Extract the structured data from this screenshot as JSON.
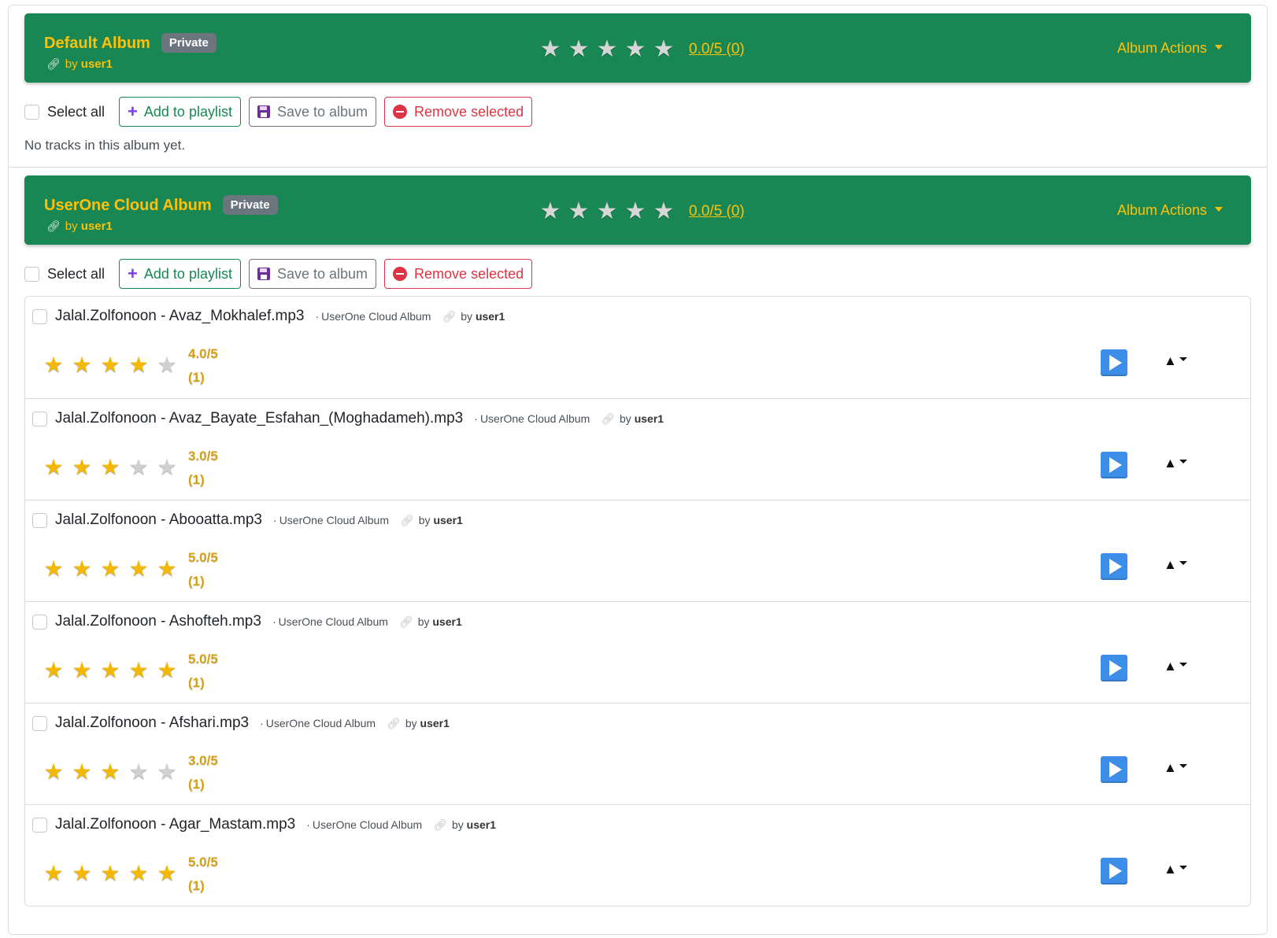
{
  "albums": [
    {
      "title": "Default Album",
      "badge": "Private",
      "owner_prefix": "by",
      "owner": "user1",
      "rating_text": "0.0/5 (0)",
      "actions_label": "Album Actions",
      "select_all": "Select all",
      "add_label": "Add to playlist",
      "save_label": "Save to album",
      "remove_label": "Remove selected",
      "empty_text": "No tracks in this album yet."
    },
    {
      "title": "UserOne Cloud Album",
      "badge": "Private",
      "owner_prefix": "by",
      "owner": "user1",
      "rating_text": "0.0/5 (0)",
      "actions_label": "Album Actions",
      "select_all": "Select all",
      "add_label": "Add to playlist",
      "save_label": "Save to album",
      "remove_label": "Remove selected"
    }
  ],
  "tracks": [
    {
      "title": "Jalal.Zolfonoon - Avaz_Mokhalef.mp3",
      "album": "UserOne Cloud Album",
      "by": "by",
      "owner": "user1",
      "rating": 4,
      "score": "4.0/5",
      "count": "(1)"
    },
    {
      "title": "Jalal.Zolfonoon - Avaz_Bayate_Esfahan_(Moghadameh).mp3",
      "album": "UserOne Cloud Album",
      "by": "by",
      "owner": "user1",
      "rating": 3,
      "score": "3.0/5",
      "count": "(1)"
    },
    {
      "title": "Jalal.Zolfonoon - Abooatta.mp3",
      "album": "UserOne Cloud Album",
      "by": "by",
      "owner": "user1",
      "rating": 5,
      "score": "5.0/5",
      "count": "(1)"
    },
    {
      "title": "Jalal.Zolfonoon - Ashofteh.mp3",
      "album": "UserOne Cloud Album",
      "by": "by",
      "owner": "user1",
      "rating": 5,
      "score": "5.0/5",
      "count": "(1)"
    },
    {
      "title": "Jalal.Zolfonoon - Afshari.mp3",
      "album": "UserOne Cloud Album",
      "by": "by",
      "owner": "user1",
      "rating": 3,
      "score": "3.0/5",
      "count": "(1)"
    },
    {
      "title": "Jalal.Zolfonoon - Agar_Mastam.mp3",
      "album": "UserOne Cloud Album",
      "by": "by",
      "owner": "user1",
      "rating": 5,
      "score": "5.0/5",
      "count": "(1)"
    }
  ],
  "colors": {
    "header_bg": "#198754",
    "header_text": "#ffc107",
    "star_on": "#f5b800",
    "play_button": "#3d8ee8"
  },
  "icons": {
    "link": "link-icon",
    "add": "plus-icon",
    "save": "floppy-icon",
    "remove": "minus-circle-icon",
    "play": "play-icon",
    "sort": "triangle-up-icon"
  }
}
